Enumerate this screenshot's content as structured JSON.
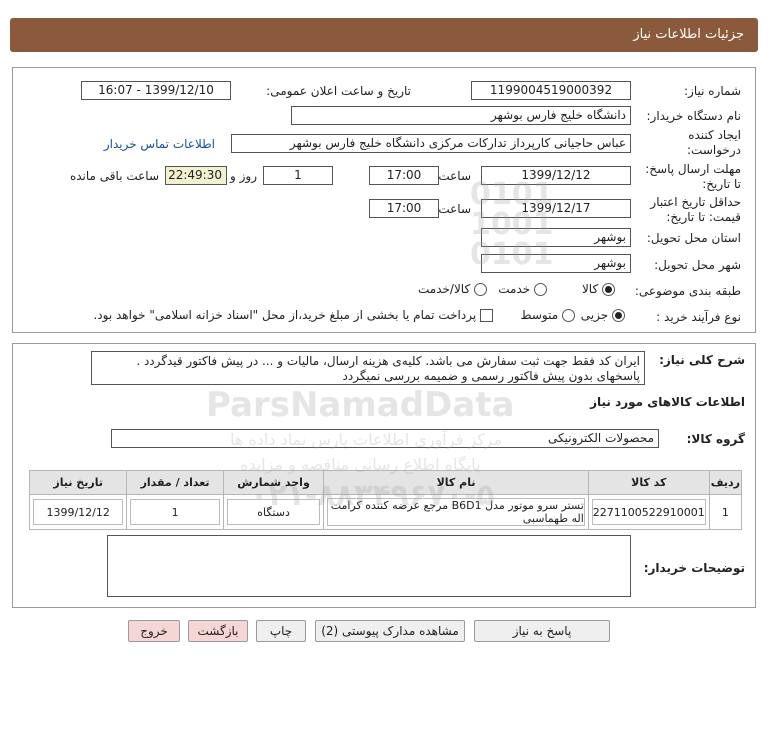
{
  "header": {
    "title": "جزئیات اطلاعات نیاز"
  },
  "form": {
    "need_number_label": "شماره نیاز:",
    "need_number": "1199004519000392",
    "announce_label": "تاریخ و ساعت اعلان عمومی:",
    "announce_value": "1399/12/10 - 16:07",
    "buyer_org_label": "نام دستگاه خریدار:",
    "buyer_org": "دانشگاه خلیج فارس بوشهر",
    "creator_label_1": "ایجاد کننده",
    "creator_label_2": "درخواست:",
    "creator": "عباس حاجیانی کارپرداز تدارکات مرکزی دانشگاه خلیج فارس بوشهر",
    "contact_link": "اطلاعات تماس خریدار",
    "deadline_label_1": "مهلت ارسال پاسخ:",
    "deadline_label_2": "تا تاریخ:",
    "deadline_date": "1399/12/12",
    "time_label": "ساعت",
    "deadline_time": "17:00",
    "days_value": "1",
    "days_label": "روز و",
    "remaining_time": "22:49:30",
    "remaining_label": "ساعت باقی مانده",
    "validity_label_1": "حداقل تاریخ اعتبار",
    "validity_label_2": "قیمت: تا تاریخ:",
    "validity_date": "1399/12/17",
    "validity_time": "17:00",
    "province_label": "استان محل تحویل:",
    "province": "بوشهر",
    "city_label": "شهر محل تحویل:",
    "city": "بوشهر",
    "category_label": "طبقه بندی موضوعی:",
    "category_options": [
      "کالا",
      "خدمت",
      "کالا/خدمت"
    ],
    "category_selected": "کالا",
    "process_label": "نوع فرآیند خرید :",
    "process_options": [
      "جزیی",
      "متوسط"
    ],
    "process_selected": "جزیی",
    "payment_note": "پرداخت تمام یا بخشی از مبلغ خرید،از محل \"اسناد خزانه اسلامی\" خواهد بود."
  },
  "details": {
    "summary_label": "شرح کلی نیاز:",
    "summary_line1": "ایران کد فقط جهت ثبت سفارش می باشد. کلیه‌ی  هزینه ارسال، مالیات و ... در پیش فاکتور قیدگردد .",
    "summary_line2": "پاسخهای بدون پیش فاکتور رسمی و ضمیمه بررسی نمیگردد",
    "goods_info_title": "اطلاعات کالاهای مورد نیاز",
    "goods_group_label": "گروه کالا:",
    "goods_group": "محصولات الکترونیکی",
    "table_headers": [
      "ردیف",
      "کد کالا",
      "نام کالا",
      "واحد شمارش",
      "تعداد / مقدار",
      "تاریخ نیاز"
    ],
    "rows": [
      {
        "index": "1",
        "code": "2271100522910001",
        "name": "تستر سرو موتور مدل B6D1 مرجع عرضه کننده کرامت اله طهماسبی",
        "unit": "دستگاه",
        "qty": "1",
        "date": "1399/12/12"
      }
    ],
    "buyer_notes_label": "توضیحات خریدار:",
    "buyer_notes": ""
  },
  "buttons": {
    "reply": "پاسخ به نیاز",
    "view_docs": "مشاهده مدارک پیوستی (2)",
    "print": "چاپ",
    "back": "بازگشت",
    "exit": "خروج"
  },
  "watermark": {
    "brand": "ParsNamadData",
    "line1": "مرکز فرآوری اطلاعات پارس نماد داده ها",
    "line2": "پایگاه اطلاع رسانی مناقصه و مزایده",
    "phone": "۰۲۱-۸۸۳۴۹۶۷۰-۵",
    "digits": "0101\n1001\n0101"
  }
}
